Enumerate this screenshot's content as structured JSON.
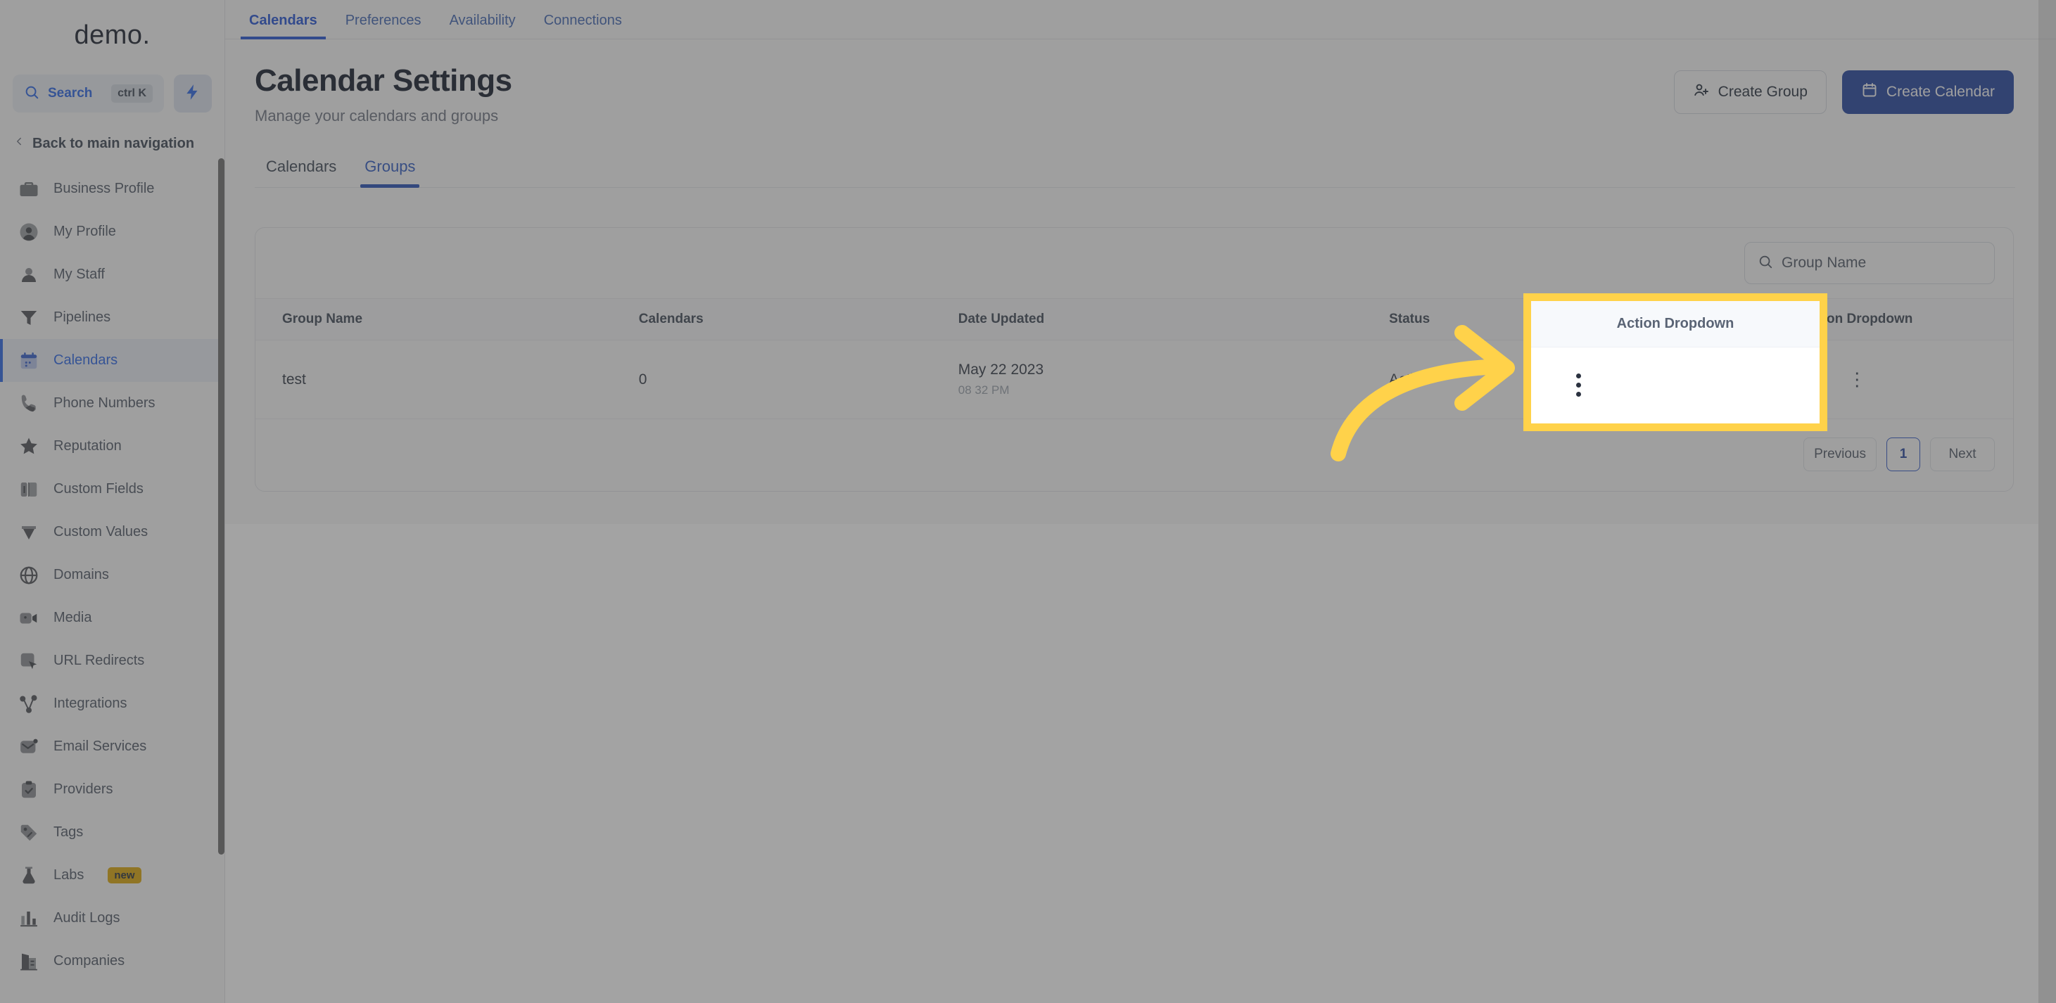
{
  "brand": {
    "name": "demo."
  },
  "sidebar": {
    "search": {
      "label": "Search",
      "shortcut": "ctrl K"
    },
    "bolt_label": "quick-actions",
    "back_label": "Back to main navigation",
    "items": [
      {
        "label": "Business Profile",
        "icon": "briefcase-icon",
        "active": false
      },
      {
        "label": "My Profile",
        "icon": "user-circle-icon",
        "active": false
      },
      {
        "label": "My Staff",
        "icon": "person-icon",
        "active": false
      },
      {
        "label": "Pipelines",
        "icon": "funnel-icon",
        "active": false
      },
      {
        "label": "Calendars",
        "icon": "calendar-icon",
        "active": true
      },
      {
        "label": "Phone Numbers",
        "icon": "phone-icon",
        "active": false
      },
      {
        "label": "Reputation",
        "icon": "star-icon",
        "active": false
      },
      {
        "label": "Custom Fields",
        "icon": "fields-icon",
        "active": false
      },
      {
        "label": "Custom Values",
        "icon": "diamond-icon",
        "active": false
      },
      {
        "label": "Domains",
        "icon": "globe-icon",
        "active": false
      },
      {
        "label": "Media",
        "icon": "video-icon",
        "active": false
      },
      {
        "label": "URL Redirects",
        "icon": "cursor-box-icon",
        "active": false
      },
      {
        "label": "Integrations",
        "icon": "nodes-icon",
        "active": false
      },
      {
        "label": "Email Services",
        "icon": "mail-icon",
        "active": false
      },
      {
        "label": "Providers",
        "icon": "clipboard-check-icon",
        "active": false
      },
      {
        "label": "Tags",
        "icon": "tag-icon",
        "active": false
      },
      {
        "label": "Labs",
        "icon": "flask-icon",
        "active": false,
        "badge": "new"
      },
      {
        "label": "Audit Logs",
        "icon": "bar-chart-icon",
        "active": false
      },
      {
        "label": "Companies",
        "icon": "building-icon",
        "active": false
      }
    ]
  },
  "topbar": {
    "tabs": [
      {
        "label": "Calendars",
        "active": true
      },
      {
        "label": "Preferences",
        "active": false
      },
      {
        "label": "Availability",
        "active": false
      },
      {
        "label": "Connections",
        "active": false
      }
    ]
  },
  "header": {
    "title": "Calendar Settings",
    "subtitle": "Manage your calendars and groups",
    "create_group_label": "Create Group",
    "create_calendar_label": "Create Calendar"
  },
  "sub_tabs": [
    {
      "label": "Calendars",
      "active": false
    },
    {
      "label": "Groups",
      "active": true
    }
  ],
  "table": {
    "search_placeholder": "Group Name",
    "search_value": "",
    "columns": [
      "Group Name",
      "Calendars",
      "Date Updated",
      "Status",
      "Action Dropdown"
    ],
    "rows": [
      {
        "group_name": "test",
        "calendars": "0",
        "date_updated": "May 22 2023",
        "time_updated": "08 32 PM",
        "status": "Active",
        "action": "⋮"
      }
    ]
  },
  "pagination": {
    "previous": "Previous",
    "page": "1",
    "next": "Next"
  },
  "highlight": {
    "title": "Action Dropdown",
    "border_color": "#FFD24A",
    "arrow_color": "#FFD24A"
  },
  "colors": {
    "accent_blue": "#1d4ed8",
    "primary_button": "#1d3fa0",
    "highlight_yellow": "#FFD24A",
    "badge_gold": "#e0a800"
  }
}
